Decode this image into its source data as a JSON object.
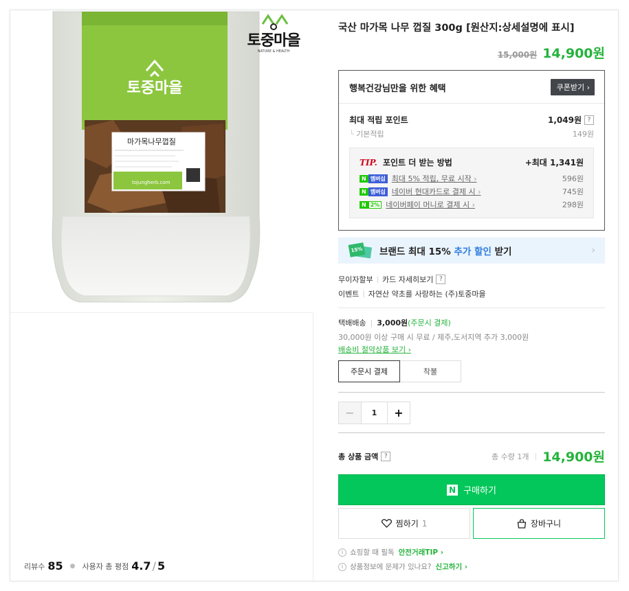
{
  "brand": {
    "logo_text": "토중마을",
    "logo_sub": "NATURE & HEALTH",
    "package_label": "마가목나무껍질",
    "package_brand": "토중마을",
    "package_site": "tojungherb.com"
  },
  "product": {
    "title": "국산 마가목 나무 껍질 300g [원산지:상세설명에 표시]",
    "original_price": "15,000원",
    "sale_price": "14,900원"
  },
  "benefit": {
    "title": "행복건강님만을 위한 혜택",
    "coupon_button": "쿠폰받기 ›",
    "max_points_label": "최대 적립 포인트",
    "max_points_value": "1,049원",
    "max_points_help": "?",
    "base_points_label": "기본적립",
    "base_points_value": "149원",
    "tip": {
      "label": "TIP.",
      "title": "포인트 더 받는 방법",
      "max": "+최대 1,341원",
      "items": [
        {
          "badge_n": "N",
          "badge_mem": "멤버십",
          "desc": "최대 5% 적립, 무료 시작",
          "value": "596원"
        },
        {
          "badge_n": "N",
          "badge_mem": "멤버십",
          "desc": "네이버 현대카드로 결제 시",
          "value": "745원"
        },
        {
          "badge_n": "N",
          "badge_mem": "2%",
          "desc": "네이버페이 머니로 결제 시",
          "value": "298원"
        }
      ]
    }
  },
  "brand_banner": {
    "badge": "15%",
    "text_pre": "브랜드 최대 15% ",
    "text_highlight": "추가 할인",
    "text_post": " 받기"
  },
  "links": {
    "installment": "무이자할부",
    "card_detail": "카드 자세히보기",
    "card_help": "?",
    "event": "이벤트",
    "event_desc": "자연산 약초를 사랑하는 (주)토중마을"
  },
  "shipping": {
    "type": "택배배송",
    "cost": "3,000원",
    "note": "(주문시 결제)",
    "desc": "30,000원 이상 구매 시 무료 / 제주,도서지역 추가 3,000원",
    "link": "배송비 절약상품 보기 ›"
  },
  "payment_options": [
    "주문시 결제",
    "착불"
  ],
  "quantity": {
    "minus": "−",
    "value": "1",
    "plus": "+"
  },
  "total": {
    "label": "총 상품 금액",
    "help": "?",
    "qty": "총 수량 1개",
    "price": "14,900원"
  },
  "buttons": {
    "buy_logo": "N",
    "buy": "구매하기",
    "wish": "찜하기",
    "wish_count": "1",
    "cart": "장바구니"
  },
  "footer": {
    "notice1": "쇼핑할 때 필독",
    "notice1_link": "안전거래TIP ›",
    "notice2": "상품정보에 문제가 있나요?",
    "notice2_link": "신고하기 ›"
  },
  "review": {
    "count_label": "리뷰수",
    "count": "85",
    "rating_label": "사용자 총 평점",
    "rating": "4.7",
    "rating_max": "5"
  },
  "colors": {
    "accent_green": "#24b33b",
    "naver_green": "#03c75a",
    "tip_red": "#d0021b",
    "banner_bg": "#eaf4fd",
    "highlight_blue": "#2f7ee0"
  }
}
